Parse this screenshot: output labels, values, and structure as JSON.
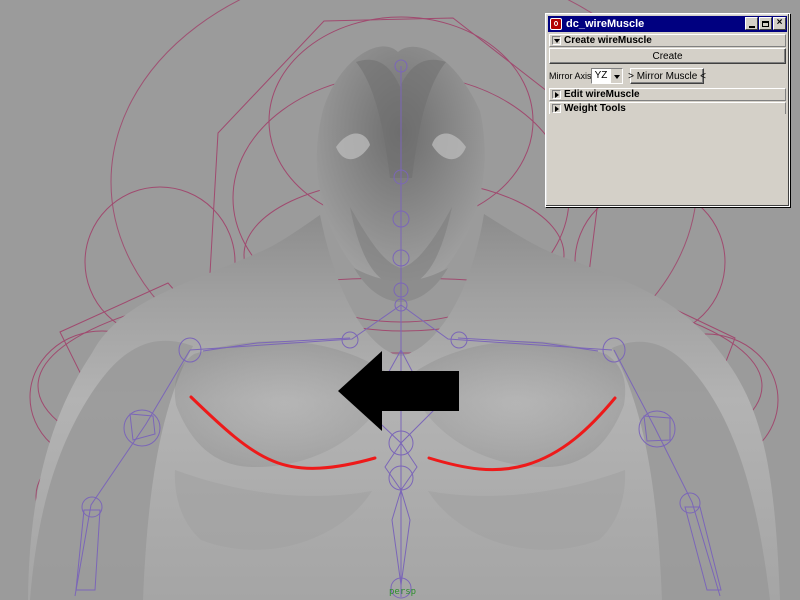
{
  "viewport": {
    "camera_label": "persp",
    "background_color": "#9b9b9b",
    "curve_color": "#ee1a1a",
    "rig_color": "#a04a6f",
    "arrow_color": "#000000"
  },
  "window": {
    "title": "dc_wireMuscle",
    "controls": {
      "minimize_icon": "minimize-icon",
      "maximize_icon": "maximize-icon",
      "close_icon": "close-icon"
    },
    "sections": {
      "create": {
        "label": "Create wireMuscle",
        "expanded": true,
        "create_button": "Create",
        "mirror_axis_label": "Mirror Axis",
        "mirror_axis_value": "YZ",
        "mirror_button": "> Mirror Muscle <"
      },
      "edit": {
        "label": "Edit wireMuscle",
        "expanded": false
      },
      "weight": {
        "label": "Weight Tools",
        "expanded": false
      }
    },
    "colors": {
      "titlebar": "#000080",
      "panel": "#d4d0c8"
    }
  }
}
